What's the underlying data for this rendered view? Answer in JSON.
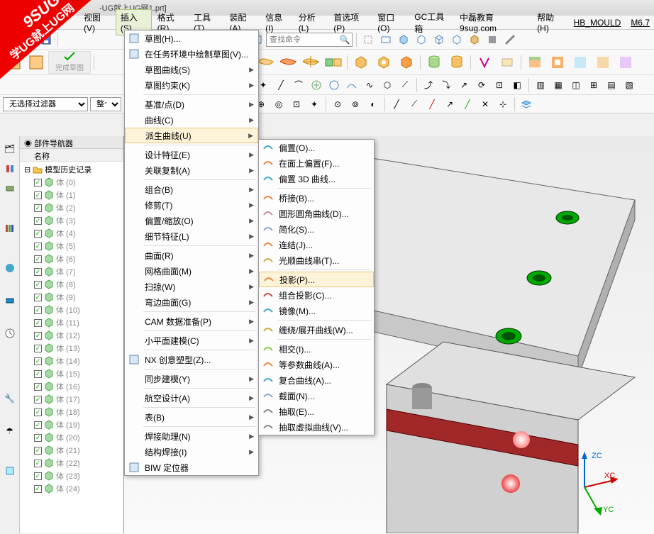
{
  "title_suffix": "-UG就上UG网1.prt]",
  "menubar": [
    "视图(V)",
    "插入(S)",
    "格式(R)",
    "工具(T)",
    "装配(A)",
    "信息(I)",
    "分析(L)",
    "首选项(P)",
    "窗口(O)",
    "GC工具箱",
    "中磊教育 9sug.com",
    "帮助(H)",
    "HB_MOULD",
    "M6.7"
  ],
  "menubar_active_index": 1,
  "search_placeholder": "查找命令",
  "finish_sketch_label": "完成草图",
  "filter_label": "无选择过滤器",
  "filter2_label": "整个",
  "nav_title": "部件导航器",
  "nav_col": "名称",
  "tree_root": "模型历史记录",
  "tree_item_prefix": "体",
  "tree_count": 25,
  "triad_labels": {
    "z": "ZC",
    "x": "XC",
    "y": "YC"
  },
  "menu_main": [
    {
      "t": "草图(H)...",
      "icon": "sketch"
    },
    {
      "t": "在任务环境中绘制草图(V)...",
      "icon": "sketch-env"
    },
    {
      "t": "草图曲线(S)",
      "sub": true
    },
    {
      "t": "草图约束(K)",
      "sub": true
    },
    {
      "sep": true
    },
    {
      "t": "基准/点(D)",
      "sub": true
    },
    {
      "t": "曲线(C)",
      "sub": true
    },
    {
      "t": "派生曲线(U)",
      "sub": true,
      "hl": true
    },
    {
      "sep": true
    },
    {
      "t": "设计特征(E)",
      "sub": true
    },
    {
      "t": "关联复制(A)",
      "sub": true
    },
    {
      "sep": true
    },
    {
      "t": "组合(B)",
      "sub": true
    },
    {
      "t": "修剪(T)",
      "sub": true
    },
    {
      "t": "偏置/缩放(O)",
      "sub": true
    },
    {
      "t": "细节特征(L)",
      "sub": true
    },
    {
      "sep": true
    },
    {
      "t": "曲面(R)",
      "sub": true
    },
    {
      "t": "网格曲面(M)",
      "sub": true
    },
    {
      "t": "扫掠(W)",
      "sub": true
    },
    {
      "t": "弯边曲面(G)",
      "sub": true
    },
    {
      "sep": true
    },
    {
      "t": "CAM 数据准备(P)",
      "sub": true
    },
    {
      "sep": true
    },
    {
      "t": "小平面建模(C)",
      "sub": true
    },
    {
      "sep": true
    },
    {
      "t": "NX 创意塑型(Z)...",
      "icon": "nx"
    },
    {
      "sep": true
    },
    {
      "t": "同步建模(Y)",
      "sub": true
    },
    {
      "sep": true
    },
    {
      "t": "航空设计(A)",
      "sub": true
    },
    {
      "sep": true
    },
    {
      "t": "表(B)",
      "sub": true
    },
    {
      "sep": true
    },
    {
      "t": "焊接助理(N)",
      "sub": true
    },
    {
      "t": "结构焊接(I)",
      "sub": true
    },
    {
      "t": "BIW 定位器",
      "icon": "biw"
    }
  ],
  "menu_sub": [
    {
      "t": "偏置(O)...",
      "i": "c1"
    },
    {
      "t": "在面上偏置(F)...",
      "i": "c2"
    },
    {
      "t": "偏置 3D 曲线...",
      "i": "c3"
    },
    {
      "sep": true
    },
    {
      "t": "桥接(B)...",
      "i": "c4"
    },
    {
      "t": "圆形圆角曲线(D)...",
      "i": "c5"
    },
    {
      "t": "简化(S)...",
      "i": "c6"
    },
    {
      "t": "连结(J)...",
      "i": "c7"
    },
    {
      "t": "光顺曲线串(T)...",
      "i": "c8"
    },
    {
      "sep": true
    },
    {
      "t": "投影(P)...",
      "i": "c9",
      "hl": true
    },
    {
      "t": "组合投影(C)...",
      "i": "c10"
    },
    {
      "t": "镜像(M)...",
      "i": "c11"
    },
    {
      "sep": true
    },
    {
      "t": "缠绕/展开曲线(W)...",
      "i": "c12"
    },
    {
      "sep": true
    },
    {
      "t": "相交(I)...",
      "i": "c13"
    },
    {
      "t": "等参数曲线(A)...",
      "i": "c14"
    },
    {
      "t": "复合曲线(A)...",
      "i": "c15"
    },
    {
      "t": "截面(N)...",
      "i": "c16"
    },
    {
      "t": "抽取(E)...",
      "i": "c17"
    },
    {
      "t": "抽取虚拟曲线(V)...",
      "i": "c18"
    }
  ]
}
